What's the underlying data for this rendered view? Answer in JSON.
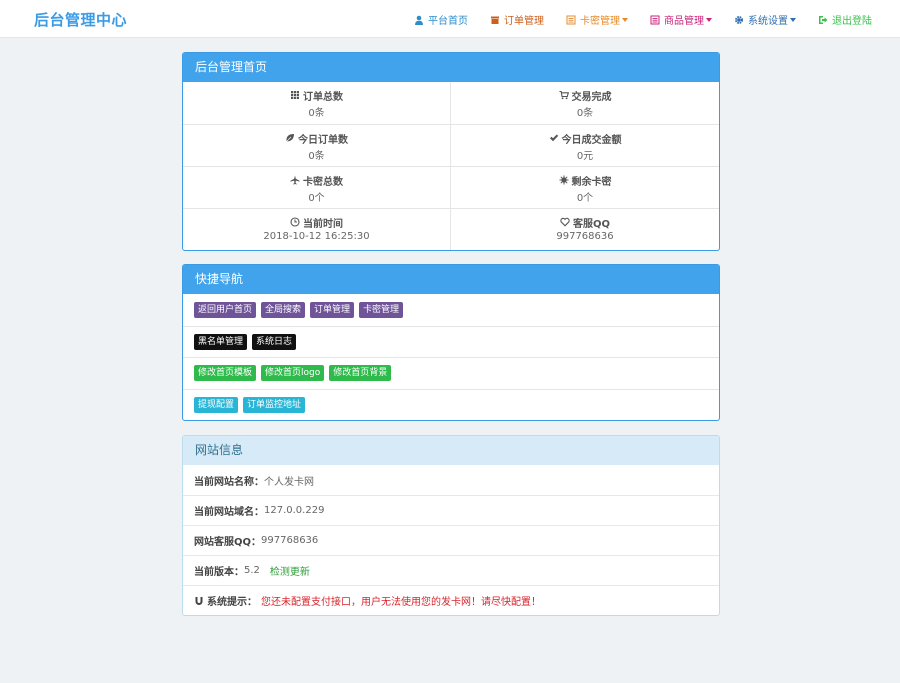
{
  "header": {
    "brand": "后台管理中心",
    "nav": [
      {
        "label": "平台首页",
        "icon": "user-icon",
        "color": "#2d8ec9",
        "dropdown": false
      },
      {
        "label": "订单管理",
        "icon": "archive-icon",
        "color": "#c9601d",
        "dropdown": false
      },
      {
        "label": "卡密管理",
        "icon": "list-icon",
        "color": "#e48c2c",
        "dropdown": true
      },
      {
        "label": "商品管理",
        "icon": "list-alt-icon",
        "color": "#c9257b",
        "dropdown": true
      },
      {
        "label": "系统设置",
        "icon": "cog-icon",
        "color": "#2f6eae",
        "dropdown": true
      },
      {
        "label": "退出登陆",
        "icon": "logout-icon",
        "color": "#3bbf4c",
        "dropdown": false
      }
    ]
  },
  "dashboard": {
    "title": "后台管理首页",
    "stats": [
      {
        "label": "订单总数",
        "value": "0条",
        "icon": "grid-icon"
      },
      {
        "label": "交易完成",
        "value": "0条",
        "icon": "cart-icon"
      },
      {
        "label": "今日订单数",
        "value": "0条",
        "icon": "leaf-icon"
      },
      {
        "label": "今日成交金额",
        "value": "0元",
        "icon": "check-icon"
      },
      {
        "label": "卡密总数",
        "value": "0个",
        "icon": "plane-icon"
      },
      {
        "label": "剩余卡密",
        "value": "0个",
        "icon": "asterisk-icon"
      },
      {
        "label": "当前时间",
        "value": "2018-10-12 16:25:30",
        "icon": "clock-icon"
      },
      {
        "label": "客服QQ",
        "value": "997768636",
        "icon": "heart-icon"
      }
    ]
  },
  "quicknav": {
    "title": "快捷导航",
    "rows": [
      {
        "color": "purple",
        "buttons": [
          "返回用户首页",
          "全局搜索",
          "订单管理",
          "卡密管理"
        ]
      },
      {
        "color": "black",
        "buttons": [
          "黑名单管理",
          "系统日志"
        ]
      },
      {
        "color": "green",
        "buttons": [
          "修改首页模板",
          "修改首页logo",
          "修改首页背景"
        ]
      },
      {
        "color": "cyan",
        "buttons": [
          "提现配置",
          "订单监控地址"
        ]
      }
    ]
  },
  "siteinfo": {
    "title": "网站信息",
    "name_label": "当前网站名称：",
    "name_value": "个人发卡网",
    "domain_label": "当前网站域名：",
    "domain_value": "127.0.0.229",
    "qq_label": "网站客服QQ：",
    "qq_value": "997768636",
    "version_label": "当前版本：",
    "version_value": "5.2",
    "update_link": "检测更新",
    "notice_label": "系统提示：",
    "notice_text": "您还未配置支付接口，用户无法使用您的发卡网！请尽快配置！"
  }
}
